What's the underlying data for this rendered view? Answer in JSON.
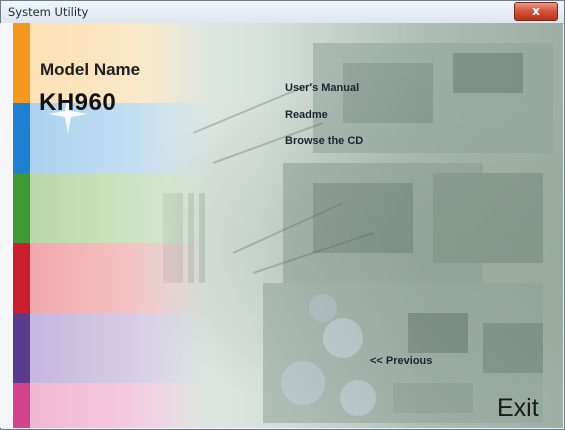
{
  "window": {
    "title": "System Utility",
    "close_symbol": "x"
  },
  "product": {
    "model_label": "Model Name",
    "model_id": "KH960"
  },
  "menu": {
    "items": [
      {
        "label": "User's Manual"
      },
      {
        "label": "Readme"
      },
      {
        "label": "Browse the CD"
      }
    ],
    "previous_label": "<< Previous",
    "exit_label": "Exit"
  },
  "colors": {
    "orange": "#f39a1e",
    "blue": "#1f7fd3",
    "green": "#3f9a34",
    "red": "#c91f2e",
    "purple": "#5a3c8c",
    "pink": "#d3438e"
  }
}
